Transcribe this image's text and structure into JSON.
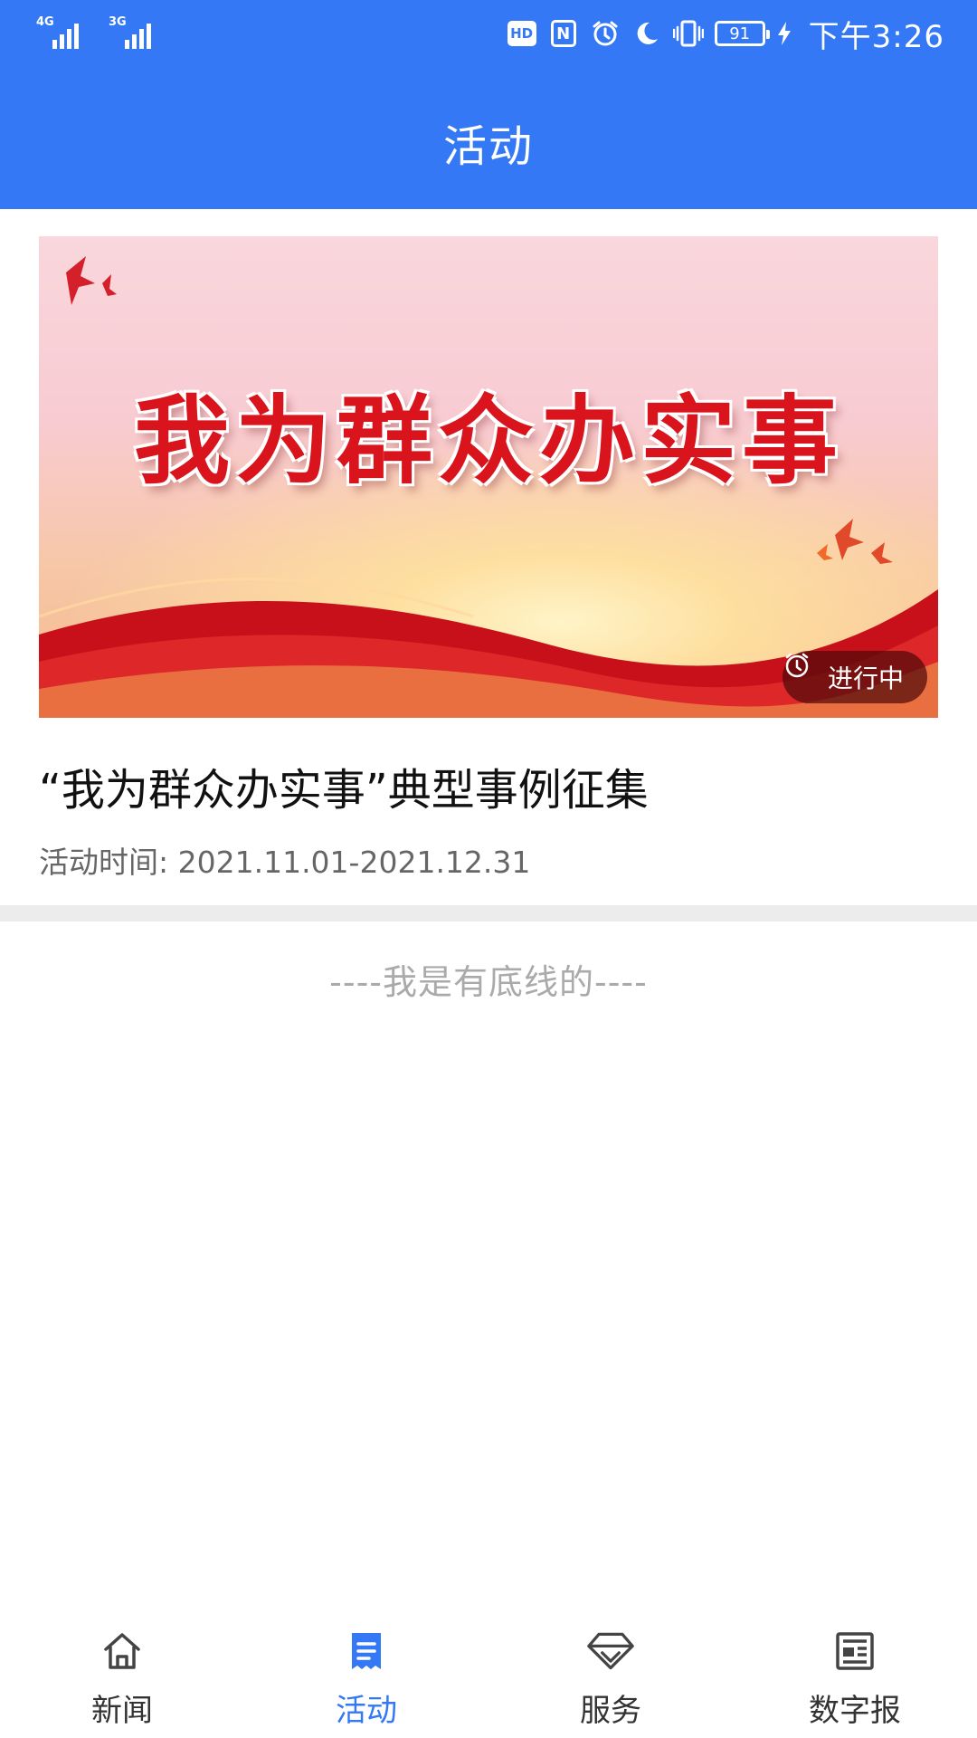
{
  "status_bar": {
    "network1": "4G",
    "network2": "3G",
    "hd": "HD",
    "nfc": "N",
    "battery": "91",
    "time": "下午3:26"
  },
  "header": {
    "title": "活动"
  },
  "activity": {
    "banner_text": "我为群众办实事",
    "status_badge": "进行中",
    "title": "“我为群众办实事”典型事例征集",
    "time": "活动时间: 2021.11.01-2021.12.31"
  },
  "footer_text": "----我是有底线的----",
  "bottom_nav": {
    "items": [
      {
        "label": "新闻",
        "icon": "home-icon",
        "active": false
      },
      {
        "label": "活动",
        "icon": "activity-icon",
        "active": true
      },
      {
        "label": "服务",
        "icon": "service-icon",
        "active": false
      },
      {
        "label": "数字报",
        "icon": "newspaper-icon",
        "active": false
      }
    ]
  },
  "colors": {
    "primary": "#3478f6",
    "banner_red": "#d9141c",
    "inactive_nav": "#333333"
  }
}
